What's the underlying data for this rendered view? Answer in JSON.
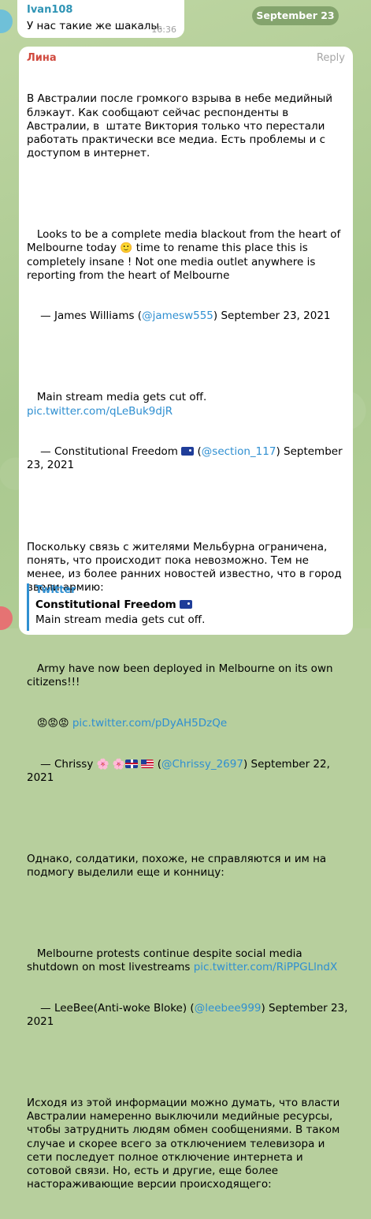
{
  "prev_message": {
    "sender": "Ivan108",
    "text": "У нас такие же шакалы.",
    "time": "16:36"
  },
  "date_pill": "September 23",
  "message": {
    "sender": "Лина",
    "reply_label": "Reply",
    "p1": "В Австралии после громкого взрыва в небе медийный блэкаут. Как сообщают сейчас респонденты в Австралии, в  штате Виктория только что перестали работать практически все медиа. Есть проблемы и с доступом в интернет.",
    "q1_text_a": "Looks to be a complete media blackout from the heart of Melbourne today",
    "q1_text_b": "time to rename this place this is completely insane ! Not one media outlet anywhere is reporting from the heart of Melbourne",
    "q1_sig_a": "— James Williams (",
    "q1_handle": "@jamesw555",
    "q1_sig_b": ") September 23, 2021",
    "q2_text": "Main stream media gets cut off.",
    "q2_link": "pic.twitter.com/qLeBuk9djR",
    "q2_sig_a": "— Constitutional Freedom",
    "q2_handle": "@section_117",
    "q2_sig_b": ") September 23, 2021",
    "p2": "Поскольку связь с жителями Мельбурна ограничена, понять, что происходит пока невозможно. Тем не менее, из более ранних новостей известно, что в город ввели армию:",
    "q3_text": "Army have now been deployed in Melbourne on its own citizens!!!",
    "q3_link": "pic.twitter.com/pDyAH5DzQe",
    "q3_sig_a": "— Chrissy",
    "q3_handle": "@Chrissy_2697",
    "q3_sig_b": ") September 22, 2021",
    "p3": "Однако, солдатики, похоже, не справляются и им на подмогу выделили еще и конницу:",
    "q4_text": "Melbourne protests continue despite social media shutdown on most livestreams",
    "q4_link": "pic.twitter.com/RiPPGLlndX",
    "q4_sig_a": "— LeeBee(Anti-woke Bloke) (",
    "q4_handle": "@leebee999",
    "q4_sig_b": ") September 23, 2021",
    "p4": "Исходя из этой информации можно думать, что власти Австралии намеренно выключили медийные ресурсы, чтобы затруднить людям обмен сообщениями. В таком случае и скорее всего за отключением телевизора и сети последует полное отключение интернета и сотовой связи. Но, есть и другие, еще более настораживающие версии происходящего:"
  },
  "link_preview": {
    "site": "Twitter",
    "title": "Constitutional Freedom",
    "text": "Main stream media gets cut off."
  },
  "colors": {
    "background": "#b7cf9d",
    "bubble": "#ffffff",
    "link": "#2f8fd1",
    "sender_top": "#2f94b5",
    "sender_main": "#d04a3f"
  },
  "icons": [
    "slightly-smiling-face-emoji",
    "angry-face-emoji",
    "cherry-blossom-emoji",
    "australia-flag",
    "uk-flag",
    "us-flag"
  ]
}
